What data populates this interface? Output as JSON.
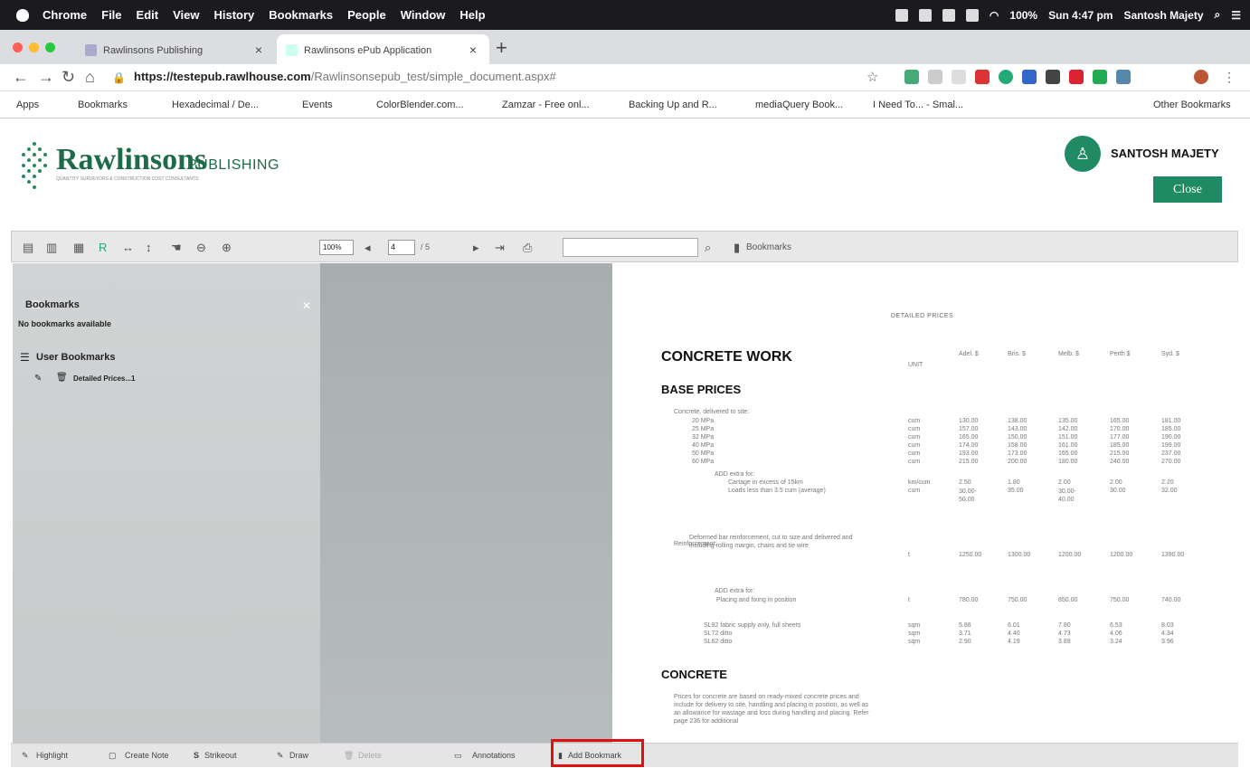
{
  "menubar": {
    "app": "Chrome",
    "items": [
      "File",
      "Edit",
      "View",
      "History",
      "Bookmarks",
      "People",
      "Window",
      "Help"
    ],
    "battery": "100%",
    "clock": "Sun 4:47 pm",
    "user": "Santosh Majety"
  },
  "tabs": [
    {
      "label": "Rawlinsons Publishing"
    },
    {
      "label": "Rawlinsons ePub Application"
    }
  ],
  "address": {
    "host": "https://testepub.rawlhouse.com",
    "path": "/Rawlinsonsepub_test/simple_document.aspx#"
  },
  "bookmarks_bar": [
    "Apps",
    "Bookmarks",
    "Hexadecimal / De...",
    "Events",
    "ColorBlender.com...",
    "Zamzar - Free onl...",
    "Backing Up and R...",
    "mediaQuery Book...",
    "I Need To... - Smal..."
  ],
  "bookmarks_other": "Other Bookmarks",
  "header": {
    "logo": "Rawlinsons",
    "logo_sub": "PUBLISHING",
    "tagline": "QUANTITY SURVEYORS & CONSTRUCTION COST CONSULTANTS",
    "user": "SANTOSH MAJETY",
    "close": "Close"
  },
  "toolbar": {
    "zoom": "100%",
    "page": "4",
    "total": "/ 5",
    "bookmarks": "Bookmarks"
  },
  "sidebar": {
    "title": "Bookmarks",
    "empty": "No bookmarks available",
    "user_title": "User Bookmarks",
    "item": "Detailed Prices...1"
  },
  "doc": {
    "section": "DETAILED PRICES",
    "h1": "CONCRETE WORK",
    "h2": "BASE PRICES",
    "h3": "CONCRETE",
    "cols": [
      "UNIT",
      "Adel. $",
      "Bris. $",
      "Melb. $",
      "Perth $",
      "Syd. $"
    ],
    "rows": [
      [
        "Concrete, delivered to site:",
        "",
        "",
        "",
        "",
        "",
        ""
      ],
      [
        "20 MPa",
        "cum",
        "130.00",
        "138.00",
        "135.00",
        "165.00",
        "181.00"
      ],
      [
        "25 MPa",
        "cum",
        "157.00",
        "143.00",
        "142.00",
        "170.00",
        "185.00"
      ],
      [
        "32 MPa",
        "cum",
        "165.00",
        "150.00",
        "151.00",
        "177.00",
        "190.00"
      ],
      [
        "40 MPa",
        "cum",
        "174.00",
        "158.00",
        "161.00",
        "185.00",
        "199.00"
      ],
      [
        "50 MPa",
        "cum",
        "193.00",
        "173.00",
        "165.00",
        "215.00",
        "237.00"
      ],
      [
        "60 MPa",
        "cum",
        "215.00",
        "200.00",
        "180.00",
        "240.00",
        "270.00"
      ],
      [
        "ADD extra for:",
        "",
        "",
        "",
        "",
        "",
        ""
      ],
      [
        "Cartage in excess of 15km",
        "km/cum",
        "2.50",
        "1.80",
        "2.00",
        "2.00",
        "2.20"
      ],
      [
        "Loads less than 3.5 cum (average)",
        "cum",
        "30.00-50.00",
        "35.00",
        "30.00-40.00",
        "30.00",
        "32.00"
      ],
      [
        "Reinforcement:",
        "",
        "",
        "",
        "",
        "",
        ""
      ],
      [
        "Deformed bar reinforcement, cut to size and delivered and including rolling margin, chairs and tie wire",
        "t",
        "1250.00",
        "1300.00",
        "1200.00",
        "1200.00",
        "1390.00"
      ],
      [
        "ADD extra for:",
        "",
        "",
        "",
        "",
        "",
        ""
      ],
      [
        "Placing and fixing in position",
        "t",
        "780.00",
        "750.00",
        "850.00",
        "750.00",
        "740.00"
      ],
      [
        "SL92 fabric supply only, full sheets",
        "sqm",
        "5.86",
        "6.01",
        "7.80",
        "6.53",
        "8.03"
      ],
      [
        "SL72 ditto",
        "sqm",
        "3.71",
        "4.40",
        "4.73",
        "4.06",
        "4.34"
      ],
      [
        "SL62 ditto",
        "sqm",
        "2.90",
        "4.19",
        "3.89",
        "3.24",
        "3.96"
      ]
    ],
    "note": "Prices for concrete are based on ready-mixed concrete prices and include for delivery to site, handling and placing in position, as well as an allowance for wastage and loss during handling and placing. Refer page 236 for additional"
  },
  "bottom": {
    "highlight": "Highlight",
    "note": "Create Note",
    "strike": "Strikeout",
    "draw": "Draw",
    "delete": "Delete",
    "annot": "Annotations",
    "addbm": "Add Bookmark"
  }
}
